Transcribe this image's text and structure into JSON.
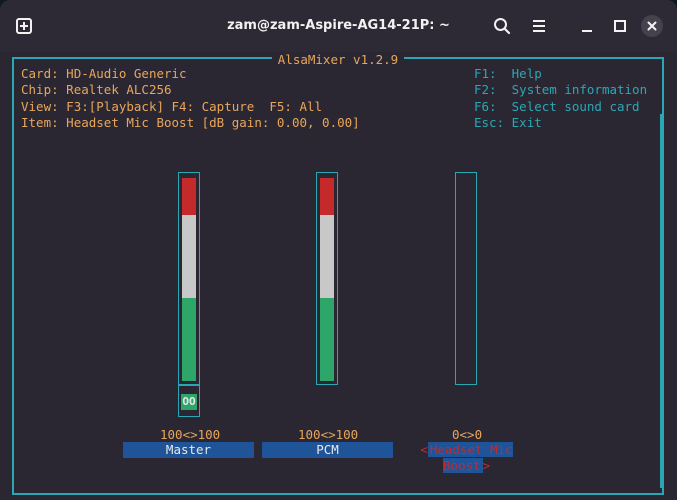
{
  "window": {
    "title": "zam@zam-Aspire-AG14-21P: ~",
    "icons": [
      "new-tab-icon",
      "search-icon",
      "menu-icon",
      "close-icon"
    ]
  },
  "mixer": {
    "title": "AlsaMixer v1.2.9",
    "card_label": "Card:",
    "card_value": "HD-Audio Generic",
    "chip_label": "Chip:",
    "chip_value": "Realtek ALC256",
    "view_label": "View:",
    "view_value": "F3:[Playback] F4: Capture  F5: All",
    "item_label": "Item:",
    "item_value": "Headset Mic Boost [dB gain: 0.00, 0.00]",
    "keys": [
      {
        "key": "F1:",
        "desc": "Help"
      },
      {
        "key": "F2:",
        "desc": "System information"
      },
      {
        "key": "F6:",
        "desc": "Select sound card"
      },
      {
        "key": "Esc:",
        "desc": "Exit"
      }
    ],
    "channels": [
      {
        "name": "Master",
        "level": "100<>100",
        "percent": 100,
        "mute": "OO",
        "selected": false
      },
      {
        "name": "PCM",
        "level": "100<>100",
        "percent": 100,
        "selected": false
      },
      {
        "name": "Headset Mic Boost",
        "level": "0<>0",
        "percent": 0,
        "selected": true
      }
    ],
    "colors": {
      "accent": "#2aa7b5",
      "text": "#e8a65a",
      "red": "#c42a2a",
      "green": "#2ea66a",
      "label_bg": "#1f5499"
    }
  }
}
